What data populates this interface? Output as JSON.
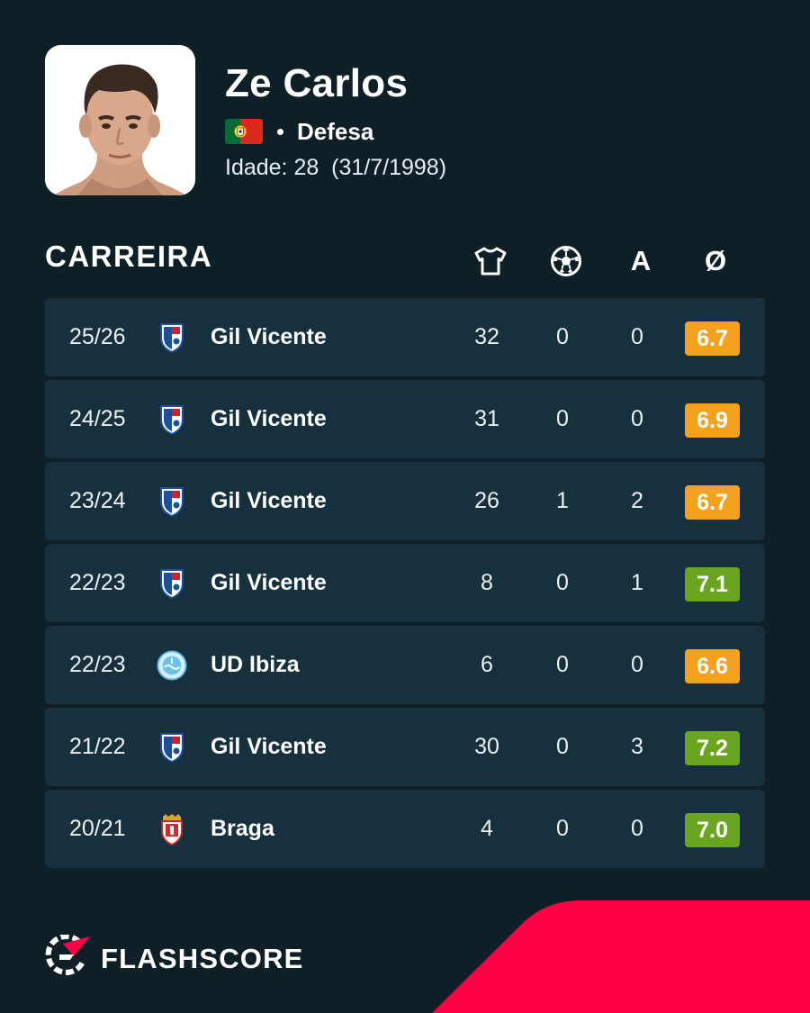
{
  "player": {
    "name": "Ze Carlos",
    "position": "Defesa",
    "age_label": "Idade: 28",
    "birth_date": "(31/7/1998)",
    "flag_icon": "portugal-flag-icon"
  },
  "career": {
    "title": "CARREIRA",
    "columns": [
      {
        "icon": "shirt-icon"
      },
      {
        "icon": "football-icon"
      },
      {
        "label": "A"
      },
      {
        "label": "Ø"
      }
    ],
    "rows": [
      {
        "season": "25/26",
        "club": "Gil Vicente",
        "crest": "gil-vicente-crest-icon",
        "apps": "32",
        "goals": "0",
        "assists": "0",
        "rating": "6.7",
        "rating_color": "#f4a11d"
      },
      {
        "season": "24/25",
        "club": "Gil Vicente",
        "crest": "gil-vicente-crest-icon",
        "apps": "31",
        "goals": "0",
        "assists": "0",
        "rating": "6.9",
        "rating_color": "#f4a11d"
      },
      {
        "season": "23/24",
        "club": "Gil Vicente",
        "crest": "gil-vicente-crest-icon",
        "apps": "26",
        "goals": "1",
        "assists": "2",
        "rating": "6.7",
        "rating_color": "#f4a11d"
      },
      {
        "season": "22/23",
        "club": "Gil Vicente",
        "crest": "gil-vicente-crest-icon",
        "apps": "8",
        "goals": "0",
        "assists": "1",
        "rating": "7.1",
        "rating_color": "#6aa51f"
      },
      {
        "season": "22/23",
        "club": "UD Ibiza",
        "crest": "ud-ibiza-crest-icon",
        "apps": "6",
        "goals": "0",
        "assists": "0",
        "rating": "6.6",
        "rating_color": "#f4a11d"
      },
      {
        "season": "21/22",
        "club": "Gil Vicente",
        "crest": "gil-vicente-crest-icon",
        "apps": "30",
        "goals": "0",
        "assists": "3",
        "rating": "7.2",
        "rating_color": "#6aa51f"
      },
      {
        "season": "20/21",
        "club": "Braga",
        "crest": "braga-crest-icon",
        "apps": "4",
        "goals": "0",
        "assists": "0",
        "rating": "7.0",
        "rating_color": "#6aa51f"
      }
    ]
  },
  "brand": {
    "name": "FLASHSCORE",
    "logo_icon": "flashscore-logo-icon",
    "accent_color": "#ff0046"
  },
  "colors": {
    "background": "#0f1f28",
    "row_background": "#16313d",
    "rating_orange": "#f4a11d",
    "rating_green": "#6aa51f"
  }
}
